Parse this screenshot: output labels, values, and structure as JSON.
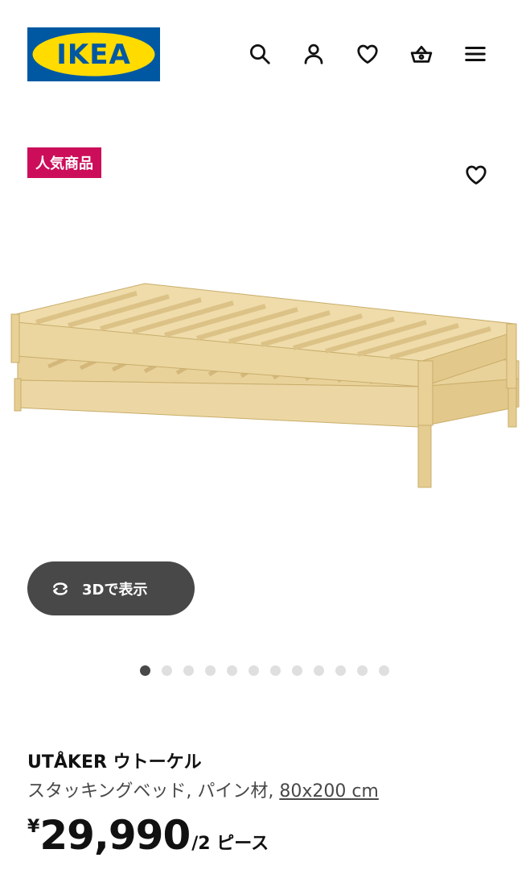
{
  "header": {
    "logo_text": "IKEA",
    "brand_colors": {
      "blue": "#0058a3",
      "yellow": "#ffdb00"
    },
    "icons": [
      "search-icon",
      "account-icon",
      "heart-icon",
      "basket-icon",
      "menu-icon"
    ]
  },
  "product": {
    "badge": "人気商品",
    "badge_color": "#cc0e5a",
    "view_3d_label": "3Dで表示",
    "carousel": {
      "count": 12,
      "active_index": 0
    },
    "name": "UTÅKER ウトーケル",
    "description": "スタッキングベッド, パイン材, ",
    "size": "80x200 cm",
    "price": {
      "currency": "¥",
      "amount": "29,990",
      "unit": "/2 ピース"
    }
  }
}
